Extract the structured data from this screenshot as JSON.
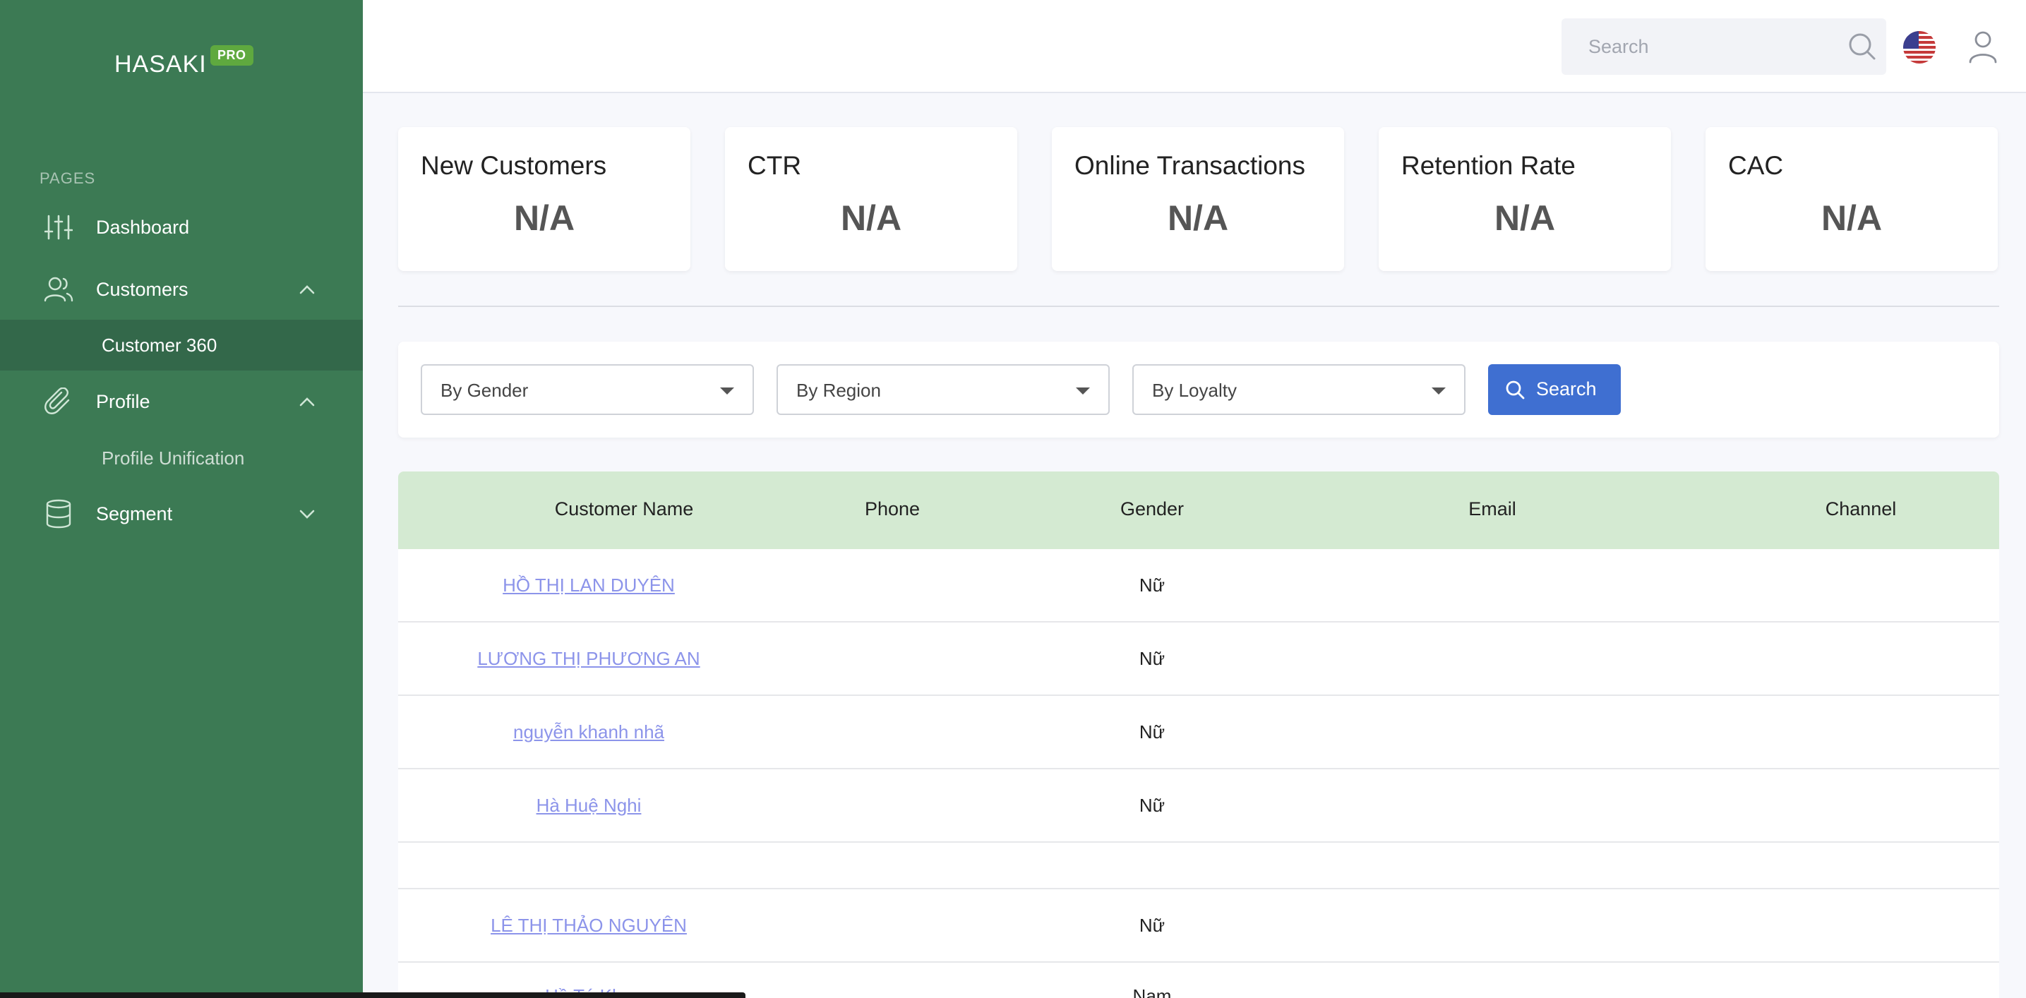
{
  "sidebar": {
    "brand": "HASAKI",
    "badge": "PRO",
    "section_label": "PAGES",
    "items": [
      {
        "label": "Dashboard",
        "icon": "sliders-icon"
      },
      {
        "label": "Customers",
        "icon": "users-icon",
        "expanded": true
      },
      {
        "label": "Customer 360",
        "sub": true,
        "active": true
      },
      {
        "label": "Profile",
        "icon": "paperclip-icon",
        "expanded": true
      },
      {
        "label": "Profile Unification",
        "sub": true
      },
      {
        "label": "Segment",
        "icon": "database-icon",
        "expanded": false
      }
    ]
  },
  "header": {
    "search_placeholder": "Search",
    "language_icon": "us-flag-icon",
    "user_icon": "user-icon"
  },
  "kpis": [
    {
      "title": "New Customers",
      "value": "N/A"
    },
    {
      "title": "CTR",
      "value": "N/A"
    },
    {
      "title": "Online Transactions",
      "value": "N/A"
    },
    {
      "title": "Retention Rate",
      "value": "N/A"
    },
    {
      "title": "CAC",
      "value": "N/A"
    }
  ],
  "filters": {
    "gender": "By Gender",
    "region": "By Region",
    "loyalty": "By Loyalty",
    "search_button": "Search"
  },
  "table": {
    "columns": [
      "Customer Name",
      "Phone",
      "Gender",
      "Email",
      "Channel"
    ],
    "rows": [
      {
        "name": "HỒ THỊ LAN DUYÊN",
        "phone": "",
        "gender": "Nữ",
        "email": "",
        "channel": ""
      },
      {
        "name": "LƯƠNG THỊ PHƯƠNG AN",
        "phone": "",
        "gender": "Nữ",
        "email": "",
        "channel": ""
      },
      {
        "name": "nguyễn khanh nhã",
        "phone": "",
        "gender": "Nữ",
        "email": "",
        "channel": ""
      },
      {
        "name": "Hà Huệ Nghi",
        "phone": "",
        "gender": "Nữ",
        "email": "",
        "channel": ""
      },
      {
        "name": "",
        "phone": "",
        "gender": "",
        "email": "",
        "channel": ""
      },
      {
        "name": "LÊ THỊ THẢO NGUYÊN",
        "phone": "",
        "gender": "Nữ",
        "email": "",
        "channel": ""
      },
      {
        "name": "Hồ Tú Kha",
        "phone": "",
        "gender": "Nam",
        "email": "",
        "channel": ""
      }
    ]
  },
  "colors": {
    "sidebar_bg": "#3c7a54",
    "active_sub_bg": "#33684a",
    "table_header_bg": "#d4ead2",
    "primary_button": "#3f6fd1",
    "link": "#8c94ea",
    "badge": "#5fa93f"
  }
}
